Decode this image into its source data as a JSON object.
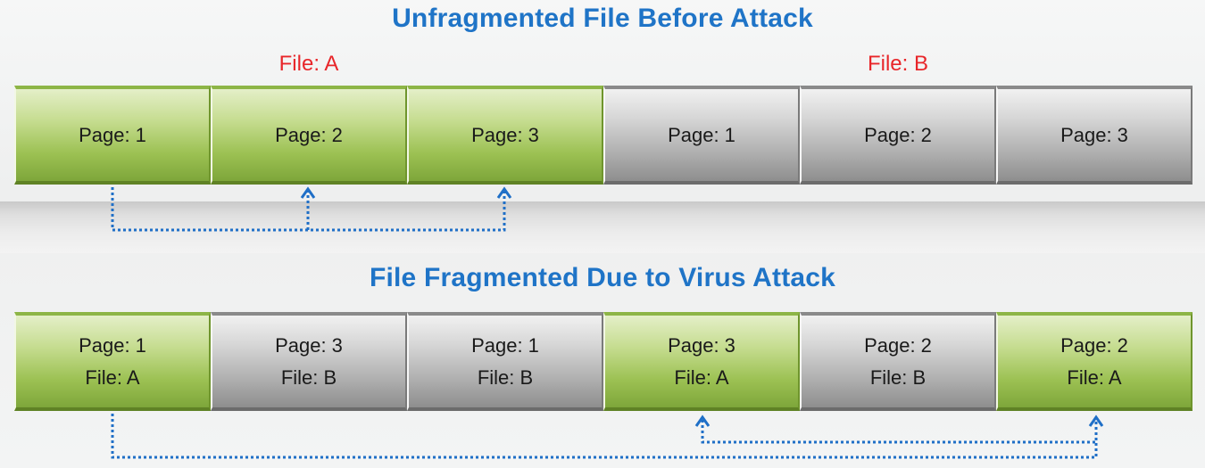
{
  "titles": {
    "before": "Unfragmented File Before Attack",
    "after": "File Fragmented Due to Virus Attack"
  },
  "file_labels": {
    "a": "File: A",
    "b": "File: B"
  },
  "before_blocks": [
    {
      "page": "Page: 1",
      "file": "A"
    },
    {
      "page": "Page: 2",
      "file": "A"
    },
    {
      "page": "Page: 3",
      "file": "A"
    },
    {
      "page": "Page: 1",
      "file": "B"
    },
    {
      "page": "Page: 2",
      "file": "B"
    },
    {
      "page": "Page: 3",
      "file": "B"
    }
  ],
  "after_blocks": [
    {
      "page": "Page: 1",
      "file_label": "File: A",
      "file": "A"
    },
    {
      "page": "Page: 3",
      "file_label": "File: B",
      "file": "B"
    },
    {
      "page": "Page: 1",
      "file_label": "File: B",
      "file": "B"
    },
    {
      "page": "Page: 3",
      "file_label": "File: A",
      "file": "A"
    },
    {
      "page": "Page: 2",
      "file_label": "File: B",
      "file": "B"
    },
    {
      "page": "Page: 2",
      "file_label": "File: A",
      "file": "A"
    }
  ],
  "colors": {
    "title": "#1f74c7",
    "file_label": "#e8262a",
    "file_a_block": "#9cc153",
    "file_b_block": "#a9a9a9",
    "arrow": "#1f6fc7"
  }
}
